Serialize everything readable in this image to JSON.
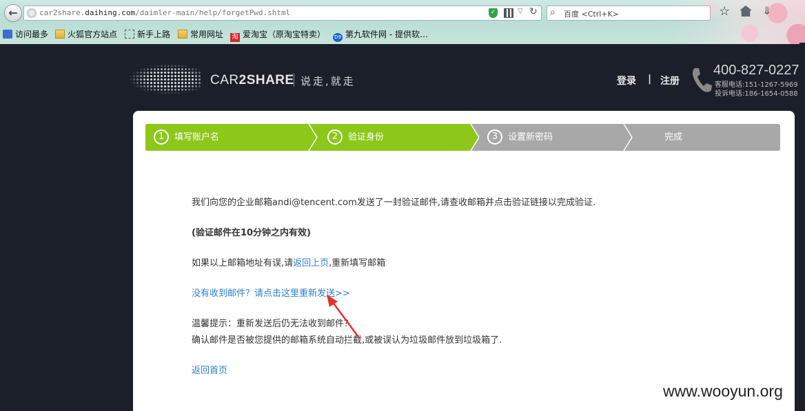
{
  "browser": {
    "url_prefix": "car2share.",
    "url_domain": "daihing.com",
    "url_path": "/daimler-main/help/forgetPwd.shtml",
    "search_placeholder": "百度 <Ctrl+K>",
    "bookmarks": [
      {
        "label": "访问最多",
        "icon": "star-icon"
      },
      {
        "label": "火狐官方站点",
        "icon": "folder-icon"
      },
      {
        "label": "新手上路",
        "icon": "page-icon"
      },
      {
        "label": "常用网址",
        "icon": "folder-icon"
      },
      {
        "label": "爱淘宝（原淘宝特卖）",
        "icon": "taobao-icon"
      },
      {
        "label": "第九软件网 - 提供软…",
        "icon": "d9-icon"
      }
    ],
    "taobao_glyph": "淘",
    "d9_glyph": "D9"
  },
  "header": {
    "brand_light": "CAR",
    "brand_bold": "2SHARE",
    "slogan": "说走,就走",
    "login": "登录",
    "separator": "|",
    "register": "注册",
    "hotline": "400-827-0227",
    "service_phone": "客服电话:151-1267-5969",
    "complaint_phone": "投诉电话:186-1654-0588"
  },
  "steps": [
    {
      "num": "1",
      "label": "填写账户名",
      "state": "done"
    },
    {
      "num": "2",
      "label": "验证身份",
      "state": "active"
    },
    {
      "num": "3",
      "label": "设置新密码",
      "state": "pending"
    },
    {
      "num": "",
      "label": "完成",
      "state": "pending"
    }
  ],
  "content": {
    "sent_before": "我们向您的企业邮箱",
    "email": "andi@tencent.com",
    "sent_after": "发送了一封验证邮件,请查收邮箱并点击验证链接以完成验证.",
    "validity": "(验证邮件在10分钟之内有效)",
    "wrong_before": "如果以上邮箱地址有误,请",
    "back_link": "返回上页",
    "wrong_after": ",重新填写邮箱",
    "resend_link": "没有收到邮件？请点击这里重新发送>>",
    "tip_line1": "温馨提示：重新发送后仍无法收到邮件？",
    "tip_line2": "确认邮件是否被您提供的邮箱系统自动拦截,或被误认为垃圾邮件放到垃圾箱了.",
    "home_link": "返回首页"
  },
  "watermark": "www.wooyun.org",
  "colors": {
    "step_active": "#8cc71a",
    "step_pending": "#a8a8a8",
    "link": "#2b7fd1",
    "page_bg": "#1b1f2a",
    "annotation_arrow": "#e8302c"
  }
}
